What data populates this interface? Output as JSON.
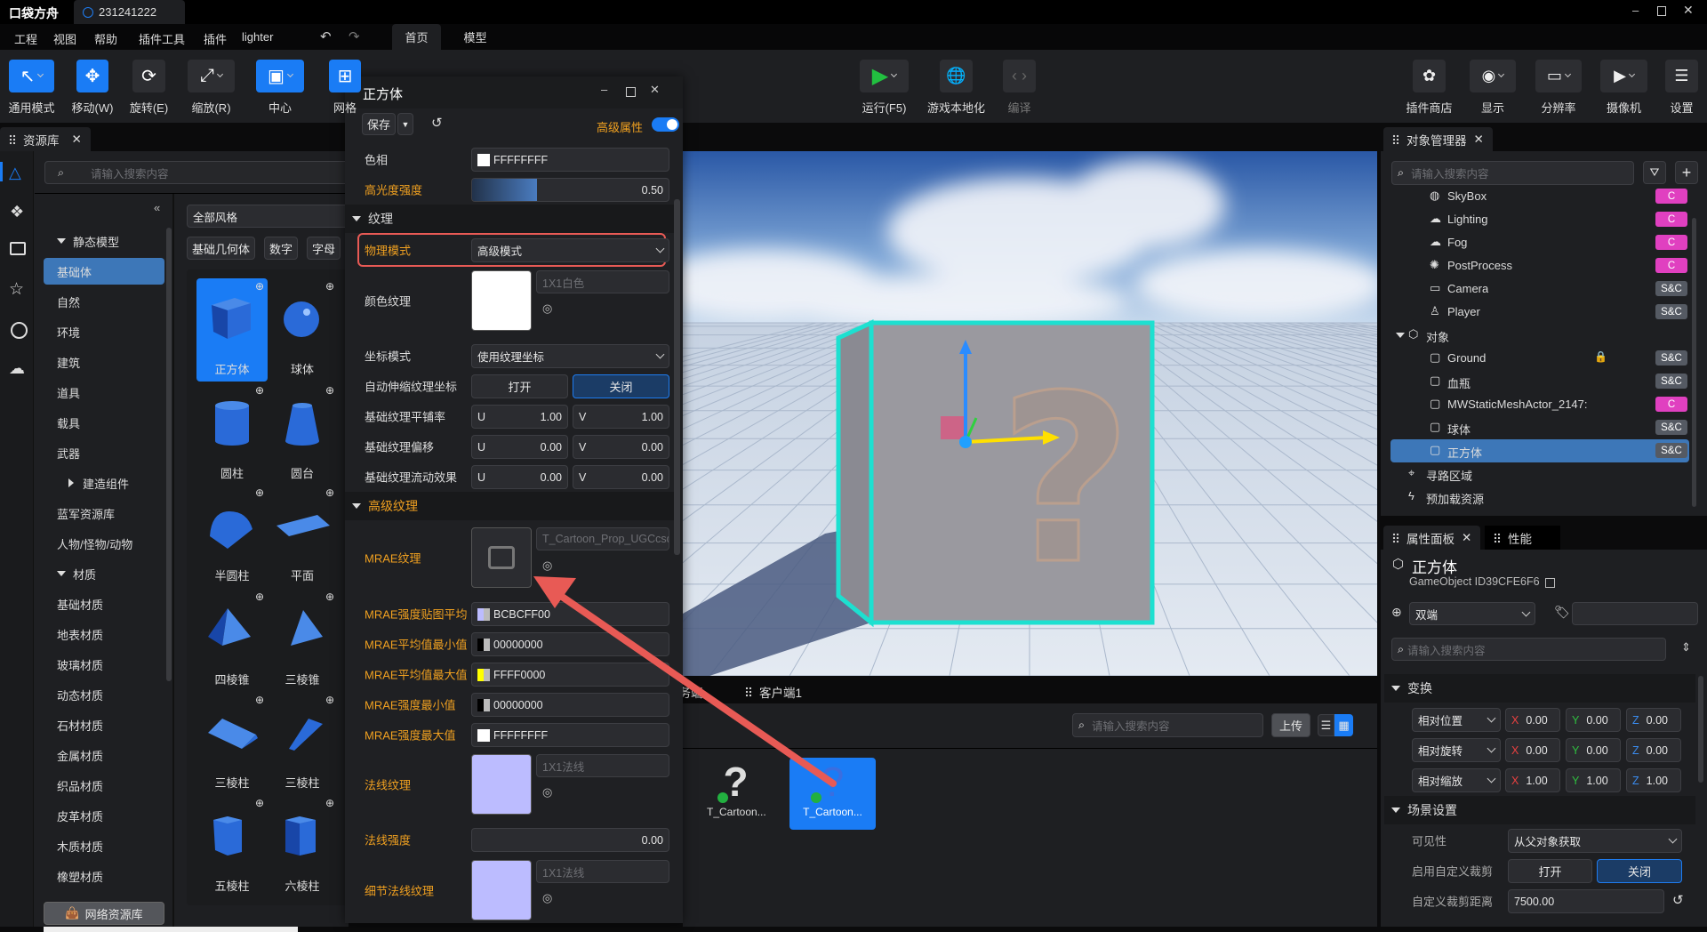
{
  "app": {
    "logo": "口袋方舟",
    "project_tab": "231241222",
    "accent": "#1a7cf5"
  },
  "menu": [
    "工程",
    "视图",
    "帮助",
    "插件工具",
    "插件",
    "lighter"
  ],
  "mode_tabs": [
    "首页",
    "模型"
  ],
  "toolbar_left": [
    {
      "label": "通用模式",
      "icon": "cursor-icon"
    },
    {
      "label": "移动(W)",
      "icon": "move-icon"
    },
    {
      "label": "旋转(E)",
      "icon": "rotate-icon"
    },
    {
      "label": "缩放(R)",
      "icon": "scale-icon"
    },
    {
      "label": "中心",
      "icon": "pivot-center-icon"
    },
    {
      "label": "网格",
      "icon": "grid-icon"
    }
  ],
  "toolbar_right": [
    {
      "label": "运行(F5)",
      "icon": "play-icon"
    },
    {
      "label": "游戏本地化",
      "icon": "globe-icon"
    },
    {
      "label": "编译",
      "icon": "code-icon"
    },
    {
      "label": "插件商店",
      "icon": "puzzle-icon"
    },
    {
      "label": "显示",
      "icon": "eye-icon"
    },
    {
      "label": "分辨率",
      "icon": "monitor-icon"
    },
    {
      "label": "摄像机",
      "icon": "video-camera-icon"
    },
    {
      "label": "设置",
      "icon": "sliders-icon"
    }
  ],
  "asset_panel": {
    "tab": "资源库",
    "search_placeholder": "请输入搜索内容",
    "style_filter": "全部风格",
    "tags": [
      "基础几何体",
      "数字",
      "字母"
    ],
    "categories": [
      {
        "label": "静态模型",
        "type": "group"
      },
      {
        "label": "基础体",
        "type": "item",
        "selected": true
      },
      {
        "label": "自然",
        "type": "item"
      },
      {
        "label": "环境",
        "type": "item"
      },
      {
        "label": "建筑",
        "type": "item"
      },
      {
        "label": "道具",
        "type": "item"
      },
      {
        "label": "载具",
        "type": "item"
      },
      {
        "label": "武器",
        "type": "item"
      },
      {
        "label": "建造组件",
        "type": "subgroup"
      },
      {
        "label": "蓝军资源库",
        "type": "item"
      },
      {
        "label": "人物/怪物/动物",
        "type": "item"
      },
      {
        "label": "材质",
        "type": "group"
      },
      {
        "label": "基础材质",
        "type": "item"
      },
      {
        "label": "地表材质",
        "type": "item"
      },
      {
        "label": "玻璃材质",
        "type": "item"
      },
      {
        "label": "动态材质",
        "type": "item"
      },
      {
        "label": "石材材质",
        "type": "item"
      },
      {
        "label": "金属材质",
        "type": "item"
      },
      {
        "label": "织品材质",
        "type": "item"
      },
      {
        "label": "皮革材质",
        "type": "item"
      },
      {
        "label": "木质材质",
        "type": "item"
      },
      {
        "label": "橡塑材质",
        "type": "item"
      }
    ],
    "network_button": "网络资源库",
    "tiles": [
      {
        "label": "正方体",
        "shape": "cube",
        "selected": true
      },
      {
        "label": "球体",
        "shape": "sphere"
      },
      {
        "label": "圆柱",
        "shape": "cylinder"
      },
      {
        "label": "圆台",
        "shape": "frustum"
      },
      {
        "label": "半圆柱",
        "shape": "half-cylinder"
      },
      {
        "label": "平面",
        "shape": "plane"
      },
      {
        "label": "四棱锥",
        "shape": "pyramid"
      },
      {
        "label": "三棱锥",
        "shape": "tetrahedron"
      },
      {
        "label": "三棱柱",
        "shape": "prism"
      },
      {
        "label": "三棱柱",
        "shape": "prism2"
      },
      {
        "label": "五棱柱",
        "shape": "pentaprism"
      },
      {
        "label": "六棱柱",
        "shape": "hexaprism"
      }
    ]
  },
  "dialog": {
    "title": "正方体",
    "save": "保存",
    "advanced_label": "高级属性",
    "advanced_on": true,
    "hue_label": "色相",
    "hue_value": "FFFFFFFF",
    "specular_label": "高光度强度",
    "specular_value": "0.50",
    "specular_fraction": 0.5,
    "texture_section": "纹理",
    "physics_label": "物理模式",
    "physics_value": "高级模式",
    "color_tex_label": "颜色纹理",
    "color_tex_value": "1X1白色",
    "coord_label": "坐标模式",
    "coord_value": "使用纹理坐标",
    "autoscale_label": "自动伸缩纹理坐标",
    "on": "打开",
    "off": "关闭",
    "tiling_label": "基础纹理平铺率",
    "tiling_u": "1.00",
    "tiling_v": "1.00",
    "offset_label": "基础纹理偏移",
    "offset_u": "0.00",
    "offset_v": "0.00",
    "flow_label": "基础纹理流动效果",
    "flow_u": "0.00",
    "flow_v": "0.00",
    "u": "U",
    "v": "V",
    "adv_section": "高级纹理",
    "mrae_label": "MRAE纹理",
    "mrae_value": "T_Cartoon_Prop_UGCcsq",
    "colors": [
      {
        "label": "MRAE强度贴图平均",
        "value": "BCBCFF00",
        "swatch": "#bcbcff"
      },
      {
        "label": "MRAE平均值最小值",
        "value": "00000000",
        "swatch": "#000000"
      },
      {
        "label": "MRAE平均值最大值",
        "value": "FFFF0000",
        "swatch": "#ffff00"
      },
      {
        "label": "MRAE强度最小值",
        "value": "00000000",
        "swatch": "#000000"
      },
      {
        "label": "MRAE强度最大值",
        "value": "FFFFFFFF",
        "swatch": "#ffffff"
      }
    ],
    "normal_label": "法线纹理",
    "normal_value": "1X1法线",
    "normal_strength_label": "法线强度",
    "normal_strength_value": "0.00",
    "detail_normal_label": "细节法线纹理",
    "detail_normal_value": "1X1法线",
    "highlight_color": "#e85a55"
  },
  "bottom_panel": {
    "tabs": [
      "服务端",
      "客户端1"
    ],
    "search_placeholder": "请输入搜索内容",
    "upload": "上传",
    "items": [
      {
        "label": "T_Cartoon..."
      },
      {
        "label": "T_Cartoon...",
        "selected": true
      }
    ]
  },
  "object_manager": {
    "tab": "对象管理器",
    "search_placeholder": "请输入搜索内容",
    "items": [
      {
        "label": "SkyBox",
        "icon": "skybox-icon",
        "badge": "C",
        "level": 2
      },
      {
        "label": "Lighting",
        "icon": "cloud-icon",
        "badge": "C",
        "level": 2
      },
      {
        "label": "Fog",
        "icon": "fog-icon",
        "badge": "C",
        "level": 2
      },
      {
        "label": "PostProcess",
        "icon": "palette-icon",
        "badge": "C",
        "level": 2
      },
      {
        "label": "Camera",
        "icon": "camera-icon",
        "badge": "S&C",
        "level": 2
      },
      {
        "label": "Player",
        "icon": "player-icon",
        "badge": "S&C",
        "level": 2
      },
      {
        "label": "对象",
        "icon": "box-icon",
        "badge": "",
        "level": 1,
        "expanded": true
      },
      {
        "label": "Ground",
        "icon": "cube-icon",
        "badge": "S&C",
        "level": 2,
        "locked": true
      },
      {
        "label": "血瓶",
        "icon": "cube-icon",
        "badge": "S&C",
        "level": 2
      },
      {
        "label": "MWStaticMeshActor_2147:",
        "icon": "cube-icon",
        "badge": "C",
        "level": 2
      },
      {
        "label": "球体",
        "icon": "cube-icon",
        "badge": "S&C",
        "level": 2
      },
      {
        "label": "正方体",
        "icon": "cube-icon",
        "badge": "S&C",
        "level": 2,
        "selected": true
      },
      {
        "label": "寻路区域",
        "icon": "navmesh-icon",
        "badge": "",
        "level": 1
      },
      {
        "label": "预加载资源",
        "icon": "lightning-icon",
        "badge": "",
        "level": 1
      }
    ],
    "badge_colors": {
      "C": "#e040c0",
      "S&C": "#555a63"
    }
  },
  "properties": {
    "tabs": [
      "属性面板",
      "性能"
    ],
    "title": "正方体",
    "id": "GameObject ID39CFE6F6",
    "net_mode": "双端",
    "search_placeholder": "请输入搜索内容",
    "transform_section": "变换",
    "transform": [
      {
        "mode": "相对位置",
        "x": "0.00",
        "y": "0.00",
        "z": "0.00"
      },
      {
        "mode": "相对旋转",
        "x": "0.00",
        "y": "0.00",
        "z": "0.00"
      },
      {
        "mode": "相对缩放",
        "x": "1.00",
        "y": "1.00",
        "z": "1.00"
      }
    ],
    "axis": {
      "x": "X",
      "y": "Y",
      "z": "Z"
    },
    "scene_section": "场景设置",
    "visibility_label": "可见性",
    "visibility_value": "从父对象获取",
    "clip_label": "启用自定义裁剪",
    "on": "打开",
    "off": "关闭",
    "clip_dist_label": "自定义裁剪距离",
    "clip_dist_value": "7500.00"
  }
}
